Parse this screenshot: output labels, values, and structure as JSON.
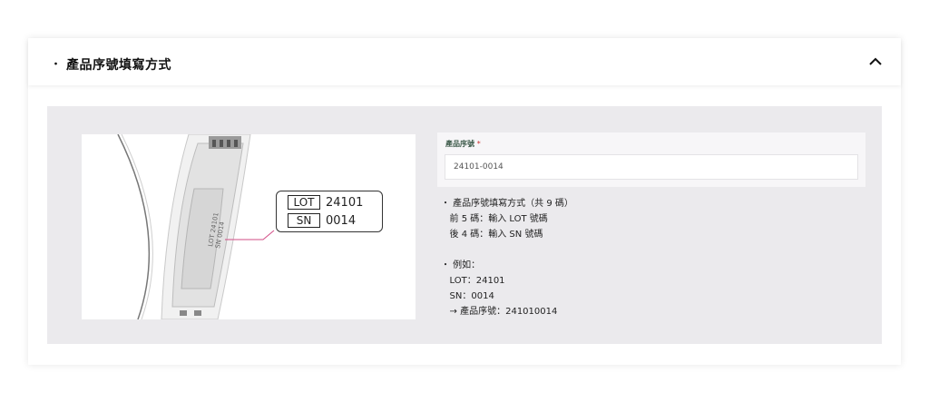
{
  "section": {
    "bullet": "・",
    "title": "產品序號填寫方式"
  },
  "illustration": {
    "lot_key": "LOT",
    "lot_value": "24101",
    "sn_key": "SN",
    "sn_value": "0014",
    "device_lot_text": "LOT 24101",
    "device_sn_text": "SN 0014"
  },
  "serial_field": {
    "label": "產品序號",
    "required_mark": "*",
    "value": "24101-0014"
  },
  "instructions": [
    "・ 產品序號填寫方式（共 9 碼）",
    "   前 5 碼：輸入 LOT 號碼",
    "   後 4 碼：輸入 SN 號碼",
    "",
    "・ 例如：",
    "   LOT：24101",
    "   SN：0014",
    "   → 產品序號：241010014"
  ],
  "icons": {
    "collapse": "chevron-up-icon"
  },
  "colors": {
    "panel_bg": "#ebeaed",
    "label_green": "#3d5a4a",
    "callout_pink": "#d24d86"
  }
}
